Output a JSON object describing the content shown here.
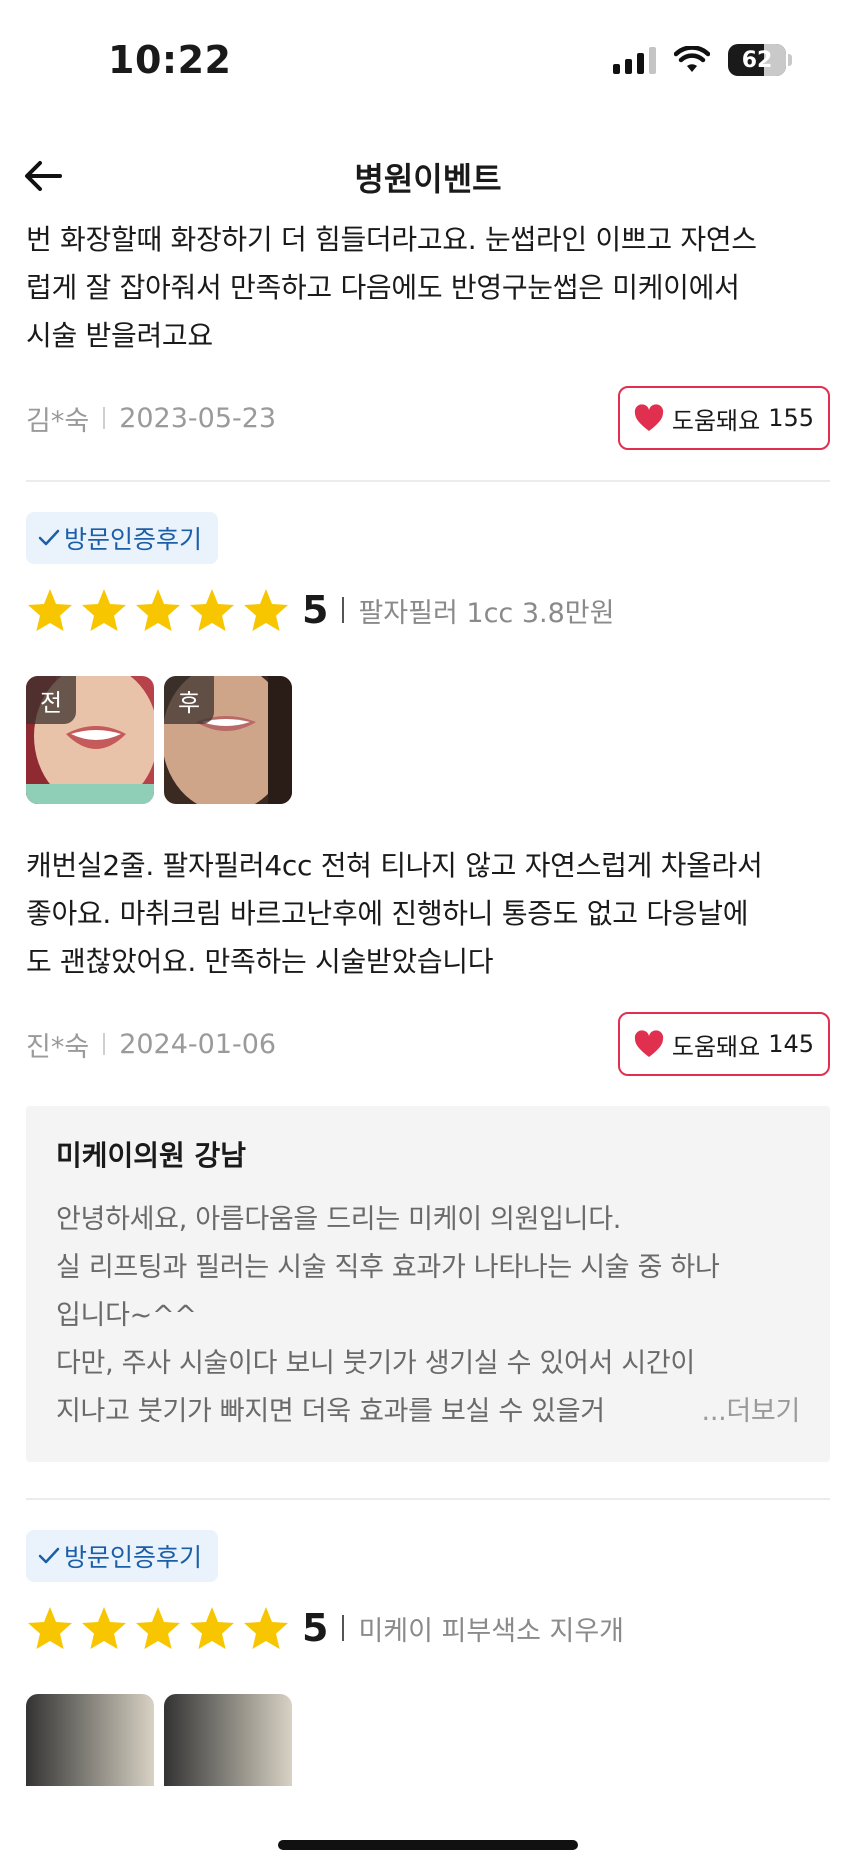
{
  "status_bar": {
    "time": "10:22",
    "battery": "62"
  },
  "header": {
    "title": "병원이벤트"
  },
  "reviews": [
    {
      "text_lines": [
        "번 화장할때 화장하기 더 힘들더라고요. 눈썹라인 이쁘고 자연스",
        "럽게 잘 잡아줘서 만족하고 다음에도 반영구눈썹은 미케이에서",
        "시술 받을려고요"
      ],
      "author": "김*숙",
      "date": "2023-05-23",
      "helpful_label": "도움돼요",
      "helpful_count": "155"
    },
    {
      "badge": "방문인증후기",
      "rating": "5",
      "treatment": "팔자필러 1cc 3.8만원",
      "photos": [
        {
          "tag": "전"
        },
        {
          "tag": "후"
        }
      ],
      "text_lines": [
        "캐번실2줄. 팔자필러4cc 전혀 티나지 않고 자연스럽게 차올라서",
        "좋아요. 마취크림 바르고난후에 진행하니 통증도 없고 다응날에",
        "도 괜찮았어요. 만족하는 시술받았습니다"
      ],
      "author": "진*숙",
      "date": "2024-01-06",
      "helpful_label": "도움돼요",
      "helpful_count": "145",
      "reply": {
        "name": "미케이의원 강남",
        "lines": [
          "안녕하세요, 아름다움을 드리는 미케이 의원입니다.",
          "실 리프팅과 필러는 시술 직후 효과가 나타나는 시술 중 하나",
          "입니다~^^",
          "다만, 주사 시술이다 보니 붓기가 생기실 수 있어서 시간이",
          "지나고 붓기가 빠지면 더욱 효과를 보실 수 있을거"
        ],
        "more": "...더보기"
      }
    },
    {
      "badge": "방문인증후기",
      "rating": "5",
      "treatment": "미케이 피부색소 지우개"
    }
  ],
  "colors": {
    "accent_red": "#e1304f",
    "star": "#f7c600",
    "badge_text": "#1c5fa8",
    "badge_bg": "#eaf3fc"
  }
}
